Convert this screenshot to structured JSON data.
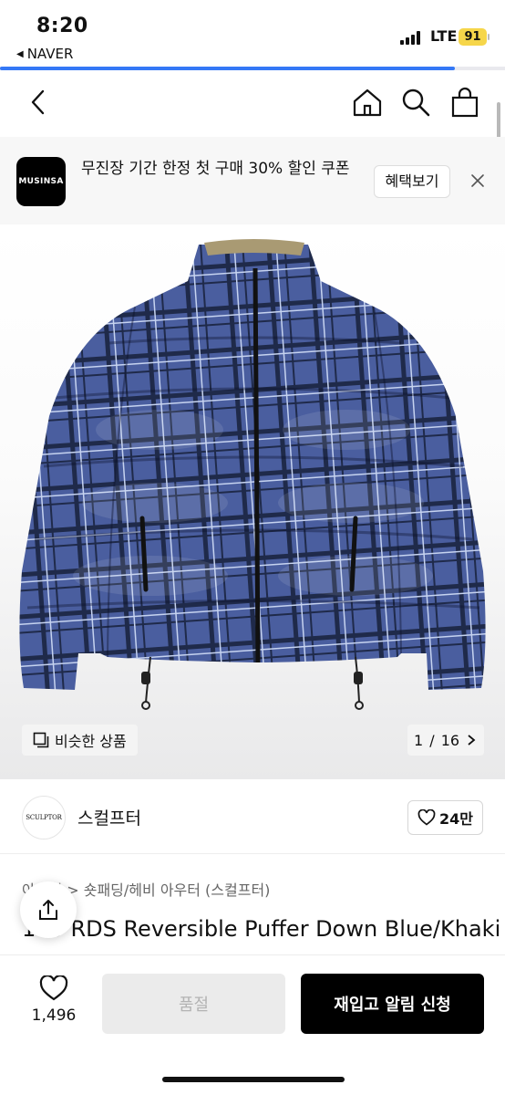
{
  "status_bar": {
    "time": "8:20",
    "back_app": "NAVER",
    "network": "LTE",
    "battery": "91",
    "page_load_progress": 0.9
  },
  "nav": {
    "icons": [
      "chevron-left-icon",
      "home-icon",
      "search-icon",
      "shopping-bag-icon"
    ]
  },
  "promo": {
    "logo_text": "MUSINSA",
    "message": "무진장 기간 한정 첫 구매 30% 할인 쿠폰",
    "cta_label": "혜택보기"
  },
  "gallery": {
    "similar_label": "비슷한 상품",
    "current": "1",
    "total": "16",
    "separator": " / ",
    "product_colors": {
      "body": "#4a5e9f",
      "lining": "#a99a73",
      "plaid_dark": "#1f2a4a",
      "plaid_light": "#c6d3f0"
    }
  },
  "brand": {
    "logo_text": "SCULPTOR",
    "name": "스컬프터",
    "likes": "24만"
  },
  "product": {
    "breadcrumb": "아우터 > 숏패딩/헤비 아우터 (스컬프터)",
    "title": "100 RDS Reversible Puffer Down Blue/Khaki"
  },
  "bottom": {
    "wish_count": "1,496",
    "soldout_label": "품절",
    "restock_label": "재입고 알림 신청"
  },
  "colors": {
    "accent_progress": "#3478f6",
    "battery": "#f6d64a",
    "primary_button": "#000000",
    "disabled_button": "#ebebeb"
  }
}
